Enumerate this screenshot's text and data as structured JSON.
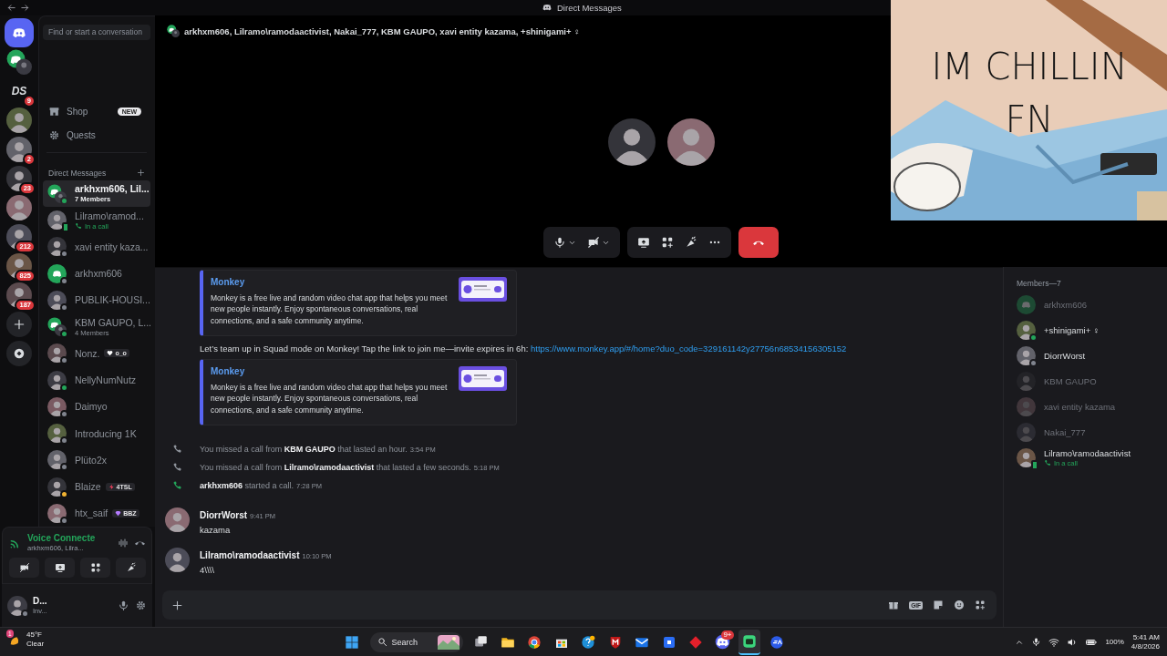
{
  "titlebar": {
    "title": "Direct Messages"
  },
  "servers": [
    {
      "kind": "home",
      "selected": true
    },
    {
      "kind": "group",
      "selected": false
    },
    {
      "kind": "text",
      "text": "DS",
      "badge": "9",
      "selected": false
    },
    {
      "kind": "picture",
      "selected": false
    },
    {
      "kind": "picture",
      "badge": "2",
      "selected": false
    },
    {
      "kind": "picture",
      "badge": "23",
      "selected": false
    },
    {
      "kind": "picture",
      "selected": false
    },
    {
      "kind": "picture",
      "badge": "212",
      "selected": false
    },
    {
      "kind": "picture",
      "badge": "825",
      "selected": false
    },
    {
      "kind": "picture",
      "badge": "187",
      "selected": false
    },
    {
      "kind": "add",
      "selected": false
    },
    {
      "kind": "discover",
      "selected": false
    }
  ],
  "search": {
    "placeholder": "Find or start a conversation"
  },
  "nav": [
    {
      "kind": "shop",
      "label": "Shop",
      "badge": "NEW"
    },
    {
      "kind": "quests",
      "label": "Quests"
    }
  ],
  "dm_header": {
    "title": "Direct Messages"
  },
  "dms": [
    {
      "kind": "group",
      "name": "arkhxm606, Lil...",
      "subtitle": {
        "kind": "members",
        "text": "7 Members"
      },
      "color": "#23a55a",
      "mobile": false,
      "selected": true
    },
    {
      "kind": "picture",
      "name": "Lilramo\\ramod...",
      "subtitle": {
        "kind": "call",
        "text": "In a call"
      },
      "color": "#23a55a",
      "mobile": true,
      "selected": false
    },
    {
      "kind": "picture",
      "name": "xavi entity kaza...",
      "color": "#80848e",
      "mobile": false,
      "selected": false
    },
    {
      "kind": "default",
      "name": "arkhxm606",
      "color": "#80848e",
      "mobile": false,
      "selected": false
    },
    {
      "kind": "picture",
      "name": "PUBLIK-HOUSI...",
      "color": "#80848e",
      "mobile": false,
      "selected": false
    },
    {
      "kind": "group",
      "name": "KBM GAUPO, L...",
      "subtitle": {
        "kind": "members",
        "text": "4 Members"
      },
      "color": "#23a55a",
      "mobile": false,
      "selected": false
    },
    {
      "kind": "picture",
      "name": "Nonz.",
      "tag": {
        "kind": "heart",
        "text": "o_o"
      },
      "color": "#80848e",
      "mobile": false,
      "selected": false
    },
    {
      "kind": "picture",
      "name": "NellyNumNutz",
      "color": "#23a55a",
      "mobile": false,
      "selected": false
    },
    {
      "kind": "picture",
      "name": "Daimyo",
      "color": "#80848e",
      "mobile": false,
      "selected": false
    },
    {
      "kind": "picture",
      "name": "Introducing 1K",
      "color": "#80848e",
      "mobile": false,
      "selected": false
    },
    {
      "kind": "picture",
      "name": "Plüto2x",
      "color": "#80848e",
      "mobile": false,
      "selected": false
    },
    {
      "kind": "picture",
      "name": "Blaize",
      "tag": {
        "kind": "bolt",
        "text": "4TSL"
      },
      "color": "#f0b232",
      "mobile": false,
      "selected": false
    },
    {
      "kind": "picture",
      "name": "htx_saif",
      "tag": {
        "kind": "gem",
        "text": "BBZ"
      },
      "color": "#80848e",
      "mobile": false,
      "selected": false
    }
  ],
  "voice": {
    "status": "Voice Connecte",
    "channel": "arkhxm606, Lilra..."
  },
  "user": {
    "name": "D...",
    "status": "Inv...",
    "color": "#80848e",
    "mobile": false
  },
  "call": {
    "title": "arkhxm606, Lilramo\\ramodaactivist, Nakai_777, KBM GAUPO, xavi entity kazama, +shinigami+ ♀",
    "tiles": [
      {
        "kind": "picture"
      },
      {
        "kind": "picture"
      }
    ],
    "controls": [
      {
        "kind": "device",
        "items": [
          {
            "kind": "mic"
          },
          {
            "kind": "camera_off"
          }
        ]
      },
      {
        "kind": "actions",
        "items": [
          {
            "kind": "share"
          },
          {
            "kind": "activities"
          },
          {
            "kind": "soundboard"
          },
          {
            "kind": "more"
          }
        ]
      },
      {
        "kind": "hangup"
      }
    ]
  },
  "meme": {
    "caption": "IM CHILLIN FN"
  },
  "messages": [
    {
      "kind": "embed",
      "provider": "Monkey",
      "description": "Monkey is a free live and random video chat app that helps you meet new people instantly. Enjoy spontaneous conversations, real connections, and a safe community anytime."
    },
    {
      "kind": "text",
      "text": "Let’s team up in Squad mode on Monkey! Tap the link to join me—invite expires in 6h:",
      "link": "https://www.monkey.app/#/home?duo_code=329161142y27756n68534156305152"
    },
    {
      "kind": "embed",
      "provider": "Monkey",
      "description": "Monkey is a free live and random video chat app that helps you meet new people instantly. Enjoy spontaneous conversations, real connections, and a safe community anytime."
    },
    {
      "kind": "call",
      "missed": true,
      "text": "You missed a call from **KBM GAUPO** that lasted an hour.",
      "time": "3:54 PM"
    },
    {
      "kind": "call",
      "missed": true,
      "text": "You missed a call from **Lilramo\\ramodaactivist** that lasted a few seconds.",
      "time": "5:18 PM"
    },
    {
      "kind": "call",
      "missed": false,
      "text": "**arkhxm606** started a call.",
      "time": "7:28 PM"
    },
    {
      "kind": "message",
      "author": "DiorrWorst",
      "time": "9:41 PM",
      "text": "kazama"
    },
    {
      "kind": "message",
      "author": "Lilramo\\ramodaactivist",
      "time": "10:10 PM",
      "text": "4\\\\\\\\"
    }
  ],
  "members": {
    "title": "Members—7",
    "items": [
      {
        "kind": "default",
        "name": "arkhxm606",
        "dimmed": true
      },
      {
        "kind": "picture",
        "name": "+shinigami+ ♀",
        "color": "#23a55a",
        "mobile": false,
        "dimmed": false
      },
      {
        "kind": "picture",
        "name": "DiorrWorst",
        "color": "#80848e",
        "mobile": false,
        "dimmed": false
      },
      {
        "kind": "picture",
        "name": "KBM GAUPO",
        "dimmed": true
      },
      {
        "kind": "picture",
        "name": "xavi entity kazama",
        "dimmed": true
      },
      {
        "kind": "picture",
        "name": "Nakai_777",
        "dimmed": true
      },
      {
        "kind": "picture",
        "name": "Lilramo\\ramodaactivist",
        "subtitle": {
          "kind": "call",
          "text": "In a call"
        },
        "color": "#23a55a",
        "mobile": true,
        "dimmed": false
      }
    ]
  },
  "composer": {
    "gif_label": "GIF"
  },
  "taskbar": {
    "weather": {
      "temp": "45°F",
      "condition": "Clear",
      "badge": "1"
    },
    "search": {
      "placeholder": "Search"
    },
    "apps": [
      {
        "kind": "start",
        "active": false
      },
      {
        "kind": "search",
        "active": false
      },
      {
        "kind": "taskview",
        "active": false
      },
      {
        "kind": "explorer",
        "active": false
      },
      {
        "kind": "browser",
        "active": false
      },
      {
        "kind": "store",
        "active": false
      },
      {
        "kind": "help",
        "active": false
      },
      {
        "kind": "shield",
        "active": false
      },
      {
        "kind": "mail",
        "active": false
      },
      {
        "kind": "square",
        "active": false
      },
      {
        "kind": "diamond",
        "active": false
      },
      {
        "kind": "chat",
        "badge": "9+",
        "active": false
      },
      {
        "kind": "app",
        "active": true
      },
      {
        "kind": "ea",
        "active": false
      }
    ],
    "tray": {
      "battery": "100%",
      "time": "5:41 AM",
      "date": "4/8/2026"
    }
  }
}
